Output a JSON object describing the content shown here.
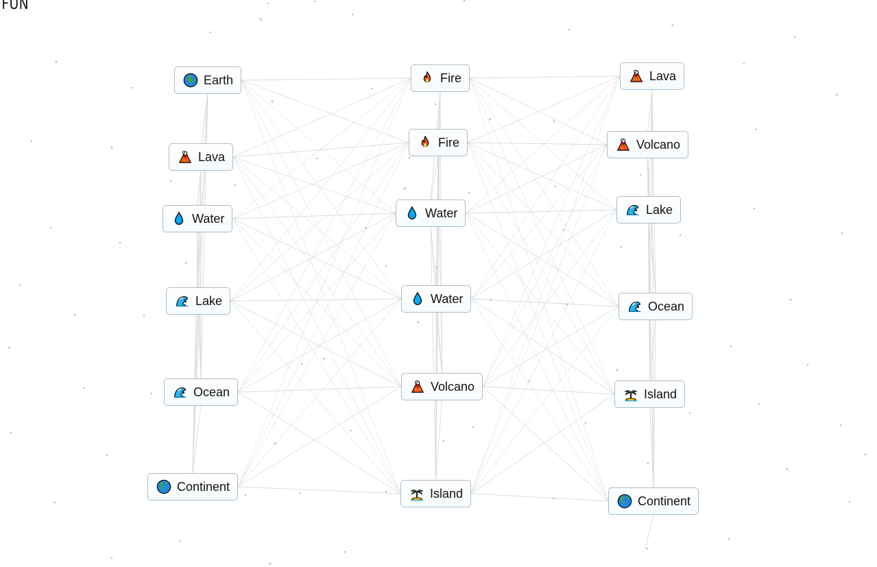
{
  "brand": {
    "text": ".FUN"
  },
  "colors": {
    "node_border": "#a9bccd",
    "edge": "#d8d8d8",
    "dot": "#9a9a9a"
  },
  "nodes": [
    {
      "id": "earth-1",
      "label": "Earth",
      "icon": "earth-africa-globe-icon",
      "column": 0
    },
    {
      "id": "lava-1",
      "label": "Lava",
      "icon": "volcano-icon",
      "column": 0
    },
    {
      "id": "water-1",
      "label": "Water",
      "icon": "droplet-icon",
      "column": 0
    },
    {
      "id": "lake-1",
      "label": "Lake",
      "icon": "wave-icon",
      "column": 0
    },
    {
      "id": "ocean-1",
      "label": "Ocean",
      "icon": "wave-icon",
      "column": 0
    },
    {
      "id": "continent-1",
      "label": "Continent",
      "icon": "earth-americas-globe-icon",
      "column": 0
    },
    {
      "id": "fire-1",
      "label": "Fire",
      "icon": "fire-icon",
      "column": 1
    },
    {
      "id": "fire-2",
      "label": "Fire",
      "icon": "fire-icon",
      "column": 1
    },
    {
      "id": "water-2",
      "label": "Water",
      "icon": "droplet-icon",
      "column": 1
    },
    {
      "id": "water-3",
      "label": "Water",
      "icon": "droplet-icon",
      "column": 1
    },
    {
      "id": "volcano-1",
      "label": "Volcano",
      "icon": "volcano-icon",
      "column": 1
    },
    {
      "id": "island-1",
      "label": "Island",
      "icon": "palm-island-icon",
      "column": 1
    },
    {
      "id": "lava-2",
      "label": "Lava",
      "icon": "volcano-icon",
      "column": 2
    },
    {
      "id": "volcano-2",
      "label": "Volcano",
      "icon": "volcano-icon",
      "column": 2
    },
    {
      "id": "lake-2",
      "label": "Lake",
      "icon": "wave-icon",
      "column": 2
    },
    {
      "id": "ocean-2",
      "label": "Ocean",
      "icon": "wave-icon",
      "column": 2
    },
    {
      "id": "island-2",
      "label": "Island",
      "icon": "palm-island-icon",
      "column": 2
    },
    {
      "id": "continent-2",
      "label": "Continent",
      "icon": "earth-americas-globe-icon",
      "column": 2
    }
  ]
}
